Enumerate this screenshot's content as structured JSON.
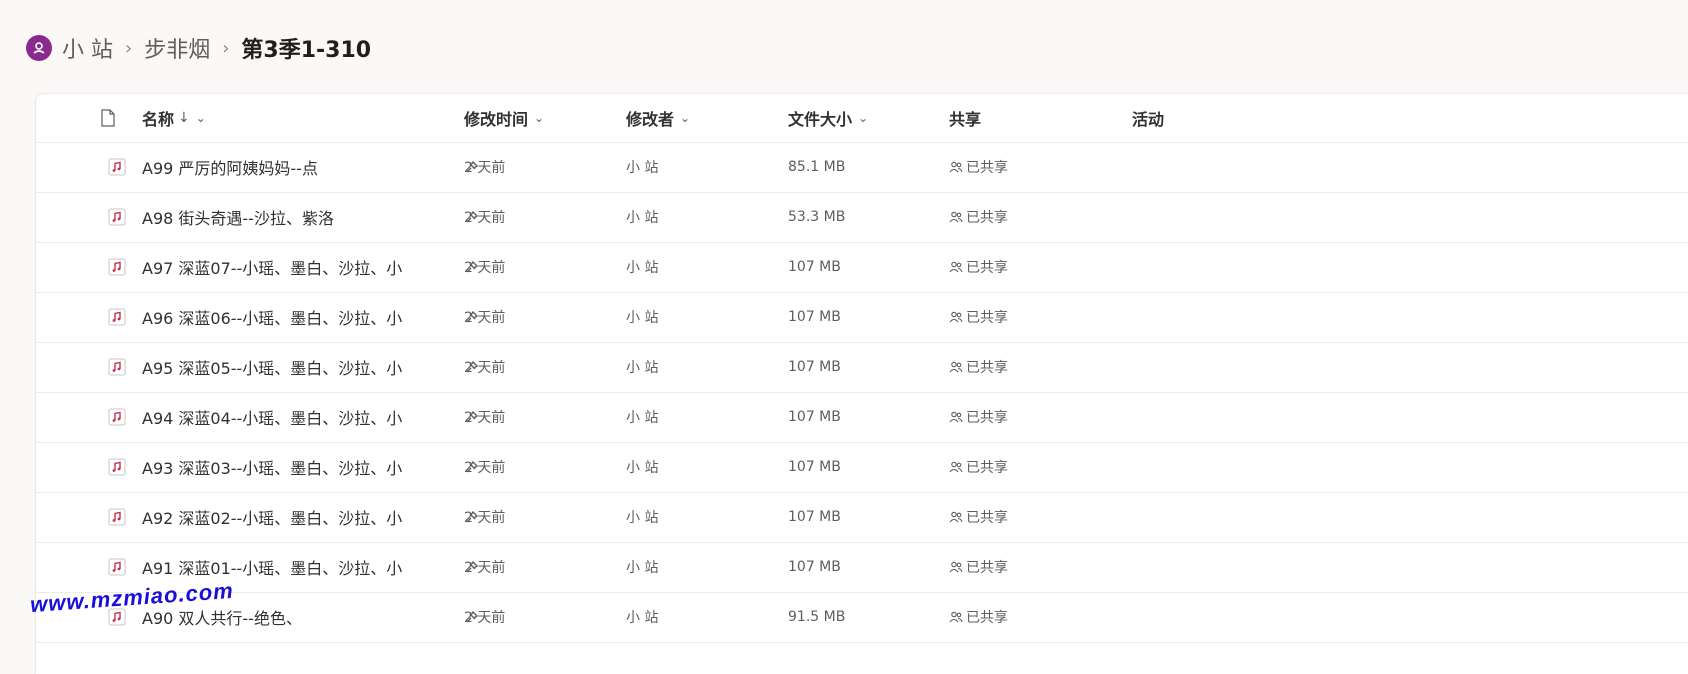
{
  "breadcrumb": {
    "site": "小 站",
    "folder": "步非烟",
    "current": "第3季1-310"
  },
  "columns": {
    "name": "名称",
    "modified": "修改时间",
    "modified_by": "修改者",
    "size": "文件大小",
    "sharing": "共享",
    "activity": "活动"
  },
  "rows": [
    {
      "name": "A99 严厉的阿姨妈妈--点",
      "modified": "2 天前",
      "modified_by": "小 站",
      "size": "85.1 MB",
      "sharing": "已共享"
    },
    {
      "name": "A98 街头奇遇--沙拉、紫洛",
      "modified": "2 天前",
      "modified_by": "小 站",
      "size": "53.3 MB",
      "sharing": "已共享"
    },
    {
      "name": "A97 深蓝07--小瑶、墨白、沙拉、小",
      "modified": "2 天前",
      "modified_by": "小 站",
      "size": "107 MB",
      "sharing": "已共享"
    },
    {
      "name": "A96 深蓝06--小瑶、墨白、沙拉、小",
      "modified": "2 天前",
      "modified_by": "小 站",
      "size": "107 MB",
      "sharing": "已共享"
    },
    {
      "name": "A95 深蓝05--小瑶、墨白、沙拉、小",
      "modified": "2 天前",
      "modified_by": "小 站",
      "size": "107 MB",
      "sharing": "已共享"
    },
    {
      "name": "A94 深蓝04--小瑶、墨白、沙拉、小",
      "modified": "2 天前",
      "modified_by": "小 站",
      "size": "107 MB",
      "sharing": "已共享"
    },
    {
      "name": "A93 深蓝03--小瑶、墨白、沙拉、小",
      "modified": "2 天前",
      "modified_by": "小 站",
      "size": "107 MB",
      "sharing": "已共享"
    },
    {
      "name": "A92 深蓝02--小瑶、墨白、沙拉、小",
      "modified": "2 天前",
      "modified_by": "小 站",
      "size": "107 MB",
      "sharing": "已共享"
    },
    {
      "name": "A91 深蓝01--小瑶、墨白、沙拉、小",
      "modified": "2 天前",
      "modified_by": "小 站",
      "size": "107 MB",
      "sharing": "已共享"
    },
    {
      "name": "A90 双人共行--绝色、",
      "modified": "2 天前",
      "modified_by": "小 站",
      "size": "91.5 MB",
      "sharing": "已共享"
    }
  ],
  "watermark": "www.mzmiao.com",
  "colors": {
    "site_icon": "#8a2a8e",
    "file_icon": "#c4314b",
    "watermark": "#1a0fd6"
  }
}
